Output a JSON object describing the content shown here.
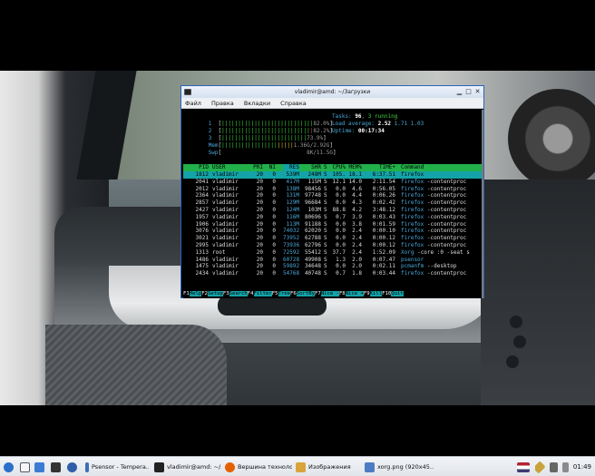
{
  "window": {
    "title": "vladimir@amd: ~/Загрузки",
    "menu": [
      "Файл",
      "Правка",
      "Вкладки",
      "Справка"
    ]
  },
  "htop": {
    "meters": [
      {
        "label": "1",
        "value": "82.0%",
        "level": 0.82
      },
      {
        "label": "2",
        "value": "82.2%",
        "level": 0.822
      },
      {
        "label": "3",
        "value": "73.9%",
        "level": 0.739
      },
      {
        "label": "Mem",
        "value": "1.36G/2.92G",
        "level": 0.47
      },
      {
        "label": "Swp",
        "value": "8K/11.5G",
        "level": 0.0
      }
    ],
    "tasks_label": "Tasks:",
    "tasks_count": "96",
    "tasks_running": "3 running",
    "load_label": "Load average:",
    "load_1": "2.52",
    "load_5": "1.71",
    "load_15": "1.03",
    "uptime_label": "Uptime:",
    "uptime": "00:17:34",
    "columns": [
      "PID",
      "USER",
      "PRI",
      "NI",
      "RES",
      "SHR",
      "S",
      "CPU%",
      "MEM%",
      "TIME+",
      "Command"
    ],
    "processes": [
      {
        "pid": "1812",
        "user": "vladimir",
        "pri": "20",
        "ni": "0",
        "res": "539M",
        "shr": "248M",
        "s": "S",
        "cpu": "105.",
        "mem": "18.1",
        "time": "6:37.51",
        "cmd": "firefox",
        "args": ""
      },
      {
        "pid": "2041",
        "user": "vladimir",
        "pri": "20",
        "ni": "0",
        "res": "417M",
        "shr": "115M",
        "s": "S",
        "cpu": "12.1",
        "mem": "14.0",
        "time": "2:11.54",
        "cmd": "firefox",
        "args": "-contentproc"
      },
      {
        "pid": "2012",
        "user": "vladimir",
        "pri": "20",
        "ni": "0",
        "res": "138M",
        "shr": "98456",
        "s": "S",
        "cpu": "0.0",
        "mem": "4.6",
        "time": "0:56.05",
        "cmd": "firefox",
        "args": "-contentproc"
      },
      {
        "pid": "2364",
        "user": "vladimir",
        "pri": "20",
        "ni": "0",
        "res": "131M",
        "shr": "97748",
        "s": "S",
        "cpu": "0.0",
        "mem": "4.4",
        "time": "0:06.26",
        "cmd": "firefox",
        "args": "-contentproc"
      },
      {
        "pid": "2857",
        "user": "vladimir",
        "pri": "20",
        "ni": "0",
        "res": "129M",
        "shr": "96684",
        "s": "S",
        "cpu": "0.0",
        "mem": "4.3",
        "time": "0:02.42",
        "cmd": "firefox",
        "args": "-contentproc"
      },
      {
        "pid": "2427",
        "user": "vladimir",
        "pri": "20",
        "ni": "0",
        "res": "124M",
        "shr": "103M",
        "s": "S",
        "cpu": "88.8",
        "mem": "4.2",
        "time": "3:48.12",
        "cmd": "firefox",
        "args": "-contentproc"
      },
      {
        "pid": "1957",
        "user": "vladimir",
        "pri": "20",
        "ni": "0",
        "res": "116M",
        "shr": "80696",
        "s": "S",
        "cpu": "0.7",
        "mem": "3.9",
        "time": "0:03.43",
        "cmd": "firefox",
        "args": "-contentproc"
      },
      {
        "pid": "1906",
        "user": "vladimir",
        "pri": "20",
        "ni": "0",
        "res": "113M",
        "shr": "91188",
        "s": "S",
        "cpu": "0.0",
        "mem": "3.8",
        "time": "0:01.59",
        "cmd": "firefox",
        "args": "-contentproc"
      },
      {
        "pid": "3076",
        "user": "vladimir",
        "pri": "20",
        "ni": "0",
        "res": "74032",
        "shr": "62020",
        "s": "S",
        "cpu": "0.0",
        "mem": "2.4",
        "time": "0:00.10",
        "cmd": "firefox",
        "args": "-contentproc"
      },
      {
        "pid": "3021",
        "user": "vladimir",
        "pri": "20",
        "ni": "0",
        "res": "73952",
        "shr": "62788",
        "s": "S",
        "cpu": "0.0",
        "mem": "2.4",
        "time": "0:00.12",
        "cmd": "firefox",
        "args": "-contentproc"
      },
      {
        "pid": "2995",
        "user": "vladimir",
        "pri": "20",
        "ni": "0",
        "res": "73936",
        "shr": "62796",
        "s": "S",
        "cpu": "0.0",
        "mem": "2.4",
        "time": "0:00.12",
        "cmd": "firefox",
        "args": "-contentproc"
      },
      {
        "pid": "1313",
        "user": "root",
        "pri": "20",
        "ni": "0",
        "res": "72592",
        "shr": "55412",
        "s": "S",
        "cpu": "37.7",
        "mem": "2.4",
        "time": "1:52.09",
        "cmd": "Xorg",
        "args": "-core :0 -seat s"
      },
      {
        "pid": "1486",
        "user": "vladimir",
        "pri": "20",
        "ni": "0",
        "res": "60728",
        "shr": "49908",
        "s": "S",
        "cpu": "1.3",
        "mem": "2.0",
        "time": "0:07.47",
        "cmd": "psensor",
        "args": ""
      },
      {
        "pid": "1475",
        "user": "vladimir",
        "pri": "20",
        "ni": "0",
        "res": "59892",
        "shr": "34648",
        "s": "S",
        "cpu": "0.0",
        "mem": "2.0",
        "time": "0:02.11",
        "cmd": "pcmanfm",
        "args": "--desktop"
      },
      {
        "pid": "2434",
        "user": "vladimir",
        "pri": "20",
        "ni": "0",
        "res": "54768",
        "shr": "40748",
        "s": "S",
        "cpu": "0.7",
        "mem": "1.8",
        "time": "0:03.44",
        "cmd": "firefox",
        "args": "-contentproc"
      }
    ],
    "fkeys": [
      {
        "key": "F1",
        "label": "Help"
      },
      {
        "key": "F2",
        "label": "Setup"
      },
      {
        "key": "F3",
        "label": "Search"
      },
      {
        "key": "F4",
        "label": "Filter"
      },
      {
        "key": "F5",
        "label": "Tree"
      },
      {
        "key": "F6",
        "label": "SortBy"
      },
      {
        "key": "F7",
        "label": "Nice -"
      },
      {
        "key": "F8",
        "label": "Nice +"
      },
      {
        "key": "F9",
        "label": "Kill"
      },
      {
        "key": "F10",
        "label": "Quit"
      }
    ]
  },
  "taskbar": {
    "tasks": [
      {
        "label": "Psensor - Tempera...",
        "icon": "psensor-icon",
        "color": "#3d6fb6"
      },
      {
        "label": "vladimir@amd: ~/3...",
        "icon": "terminal-icon",
        "color": "#222222"
      },
      {
        "label": "Вершина технолог...",
        "icon": "firefox-icon",
        "color": "#e66000"
      },
      {
        "label": "Изображения",
        "icon": "folder-icon",
        "color": "#d9a43a"
      },
      {
        "label": "xorg.png (920x45...",
        "icon": "image-viewer-icon",
        "color": "#4c7cc2"
      }
    ],
    "clock": "01:49"
  }
}
